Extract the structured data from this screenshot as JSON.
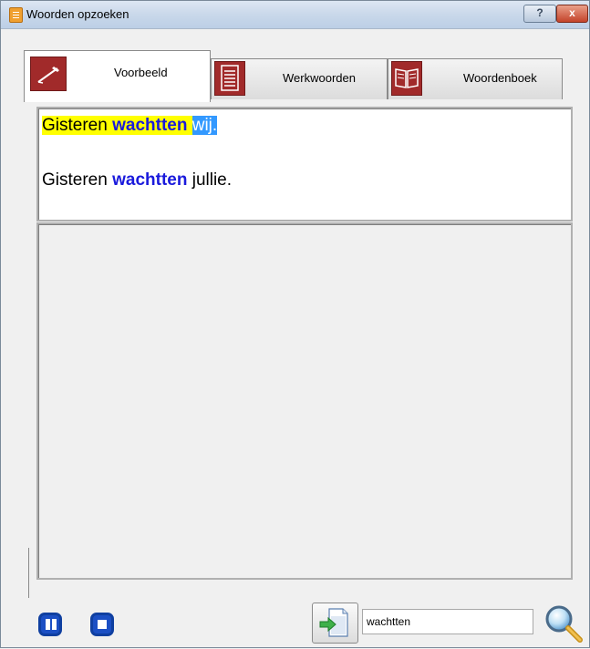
{
  "window": {
    "title": "Woorden opzoeken",
    "help_label": "?",
    "close_label": "x"
  },
  "tabs": [
    {
      "label": "Voorbeeld",
      "icon": "pen-icon",
      "active": true
    },
    {
      "label": "Werkwoorden",
      "icon": "document-list-icon",
      "active": false
    },
    {
      "label": "Woordenboek",
      "icon": "open-book-icon",
      "active": false
    }
  ],
  "examples": [
    {
      "prefix": "Gisteren ",
      "verb": "wachtten",
      "suffix": "wij."
    },
    {
      "prefix": "Gisteren ",
      "verb": "wachtten",
      "suffix": " jullie."
    }
  ],
  "search": {
    "value": "wachtten"
  },
  "colors": {
    "highlight": "#ffff00",
    "verb": "#1a1adc",
    "selection": "#3399ff",
    "tab_icon": "#a12a2a",
    "control_blue": "#1b4fc4"
  }
}
